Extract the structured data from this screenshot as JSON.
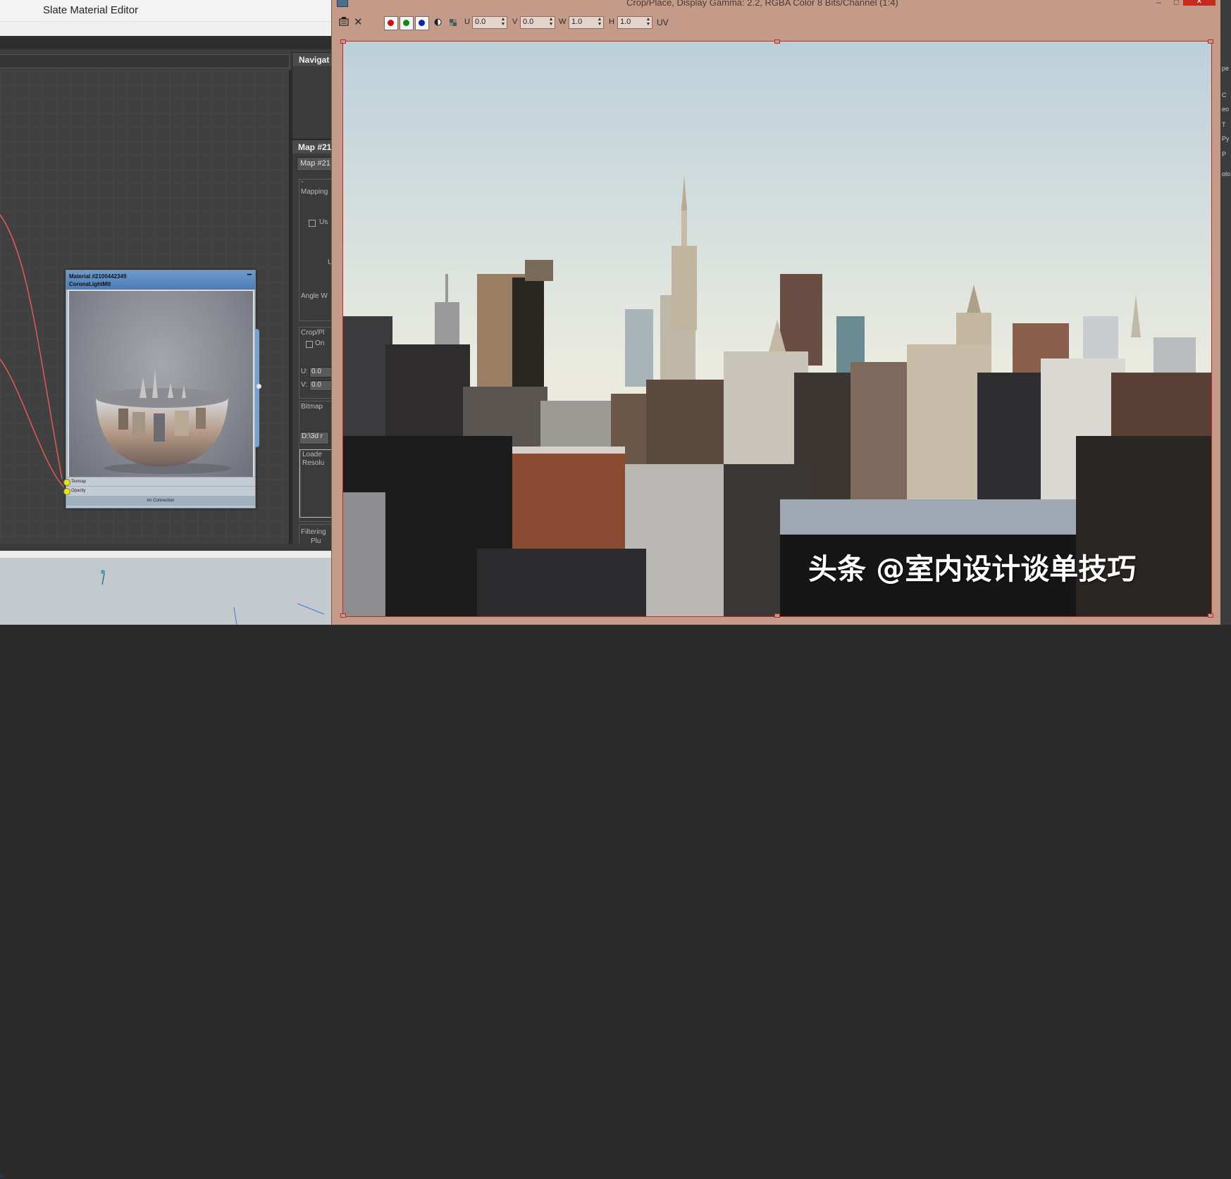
{
  "slate": {
    "title": "Slate Material Editor",
    "navigator_title": "Navigat",
    "node": {
      "name": "Material #2100442349",
      "type": "CoronaLightMtl",
      "minimize_glyph": "━",
      "slots": [
        "Texmap",
        "Opacity"
      ],
      "connection_label": "mr Connection"
    },
    "map_panel": {
      "title": "Map #21",
      "name_field": "Map #21",
      "rollout_toggle": "-",
      "mapping_label": "Mapping",
      "use_label": "Us",
      "u_label": "U",
      "angle_label": "Angle W",
      "crop_label": "Crop/Pl",
      "on_label": "On",
      "u_field_label": "U:",
      "u_value": "0.0",
      "v_field_label": "V:",
      "v_value": "0.0",
      "bitmap_label": "Bitmap",
      "bitmap_path": "D:\\3d r",
      "info_line1": "Loade",
      "info_line2": "Resolu",
      "filtering_label": "Filtering",
      "plu_label": "Plu"
    },
    "viewport_link": "s"
  },
  "crop_window": {
    "title": "Crop/Place, Display Gamma: 2.2, RGBA Color 8 Bits/Channel (1:4)",
    "toolbar": {
      "save_icon": "save-icon",
      "close_glyph": "✕",
      "u_label": "U",
      "u_value": "0.0",
      "v_label": "V",
      "v_value": "0.0",
      "w_label": "W",
      "w_value": "1.0",
      "h_label": "H",
      "h_value": "1.0",
      "uv_label": "UV"
    },
    "watermark": "头条 @室内设计谈单技巧",
    "min_glyph": "–",
    "max_glyph": "□",
    "close_btn": "✕"
  },
  "right_strip": {
    "items": [
      "pe",
      "C",
      "eo",
      "T",
      "Py",
      "P",
      "olo"
    ]
  },
  "colors": {
    "crop_chrome": "#c49a88",
    "crop_frame": "#bb2a2a",
    "node_header": "#5b89bf",
    "wire": "#e05a5a",
    "red_channel": "#cc1111",
    "green_channel": "#118811",
    "blue_channel": "#1122aa"
  }
}
